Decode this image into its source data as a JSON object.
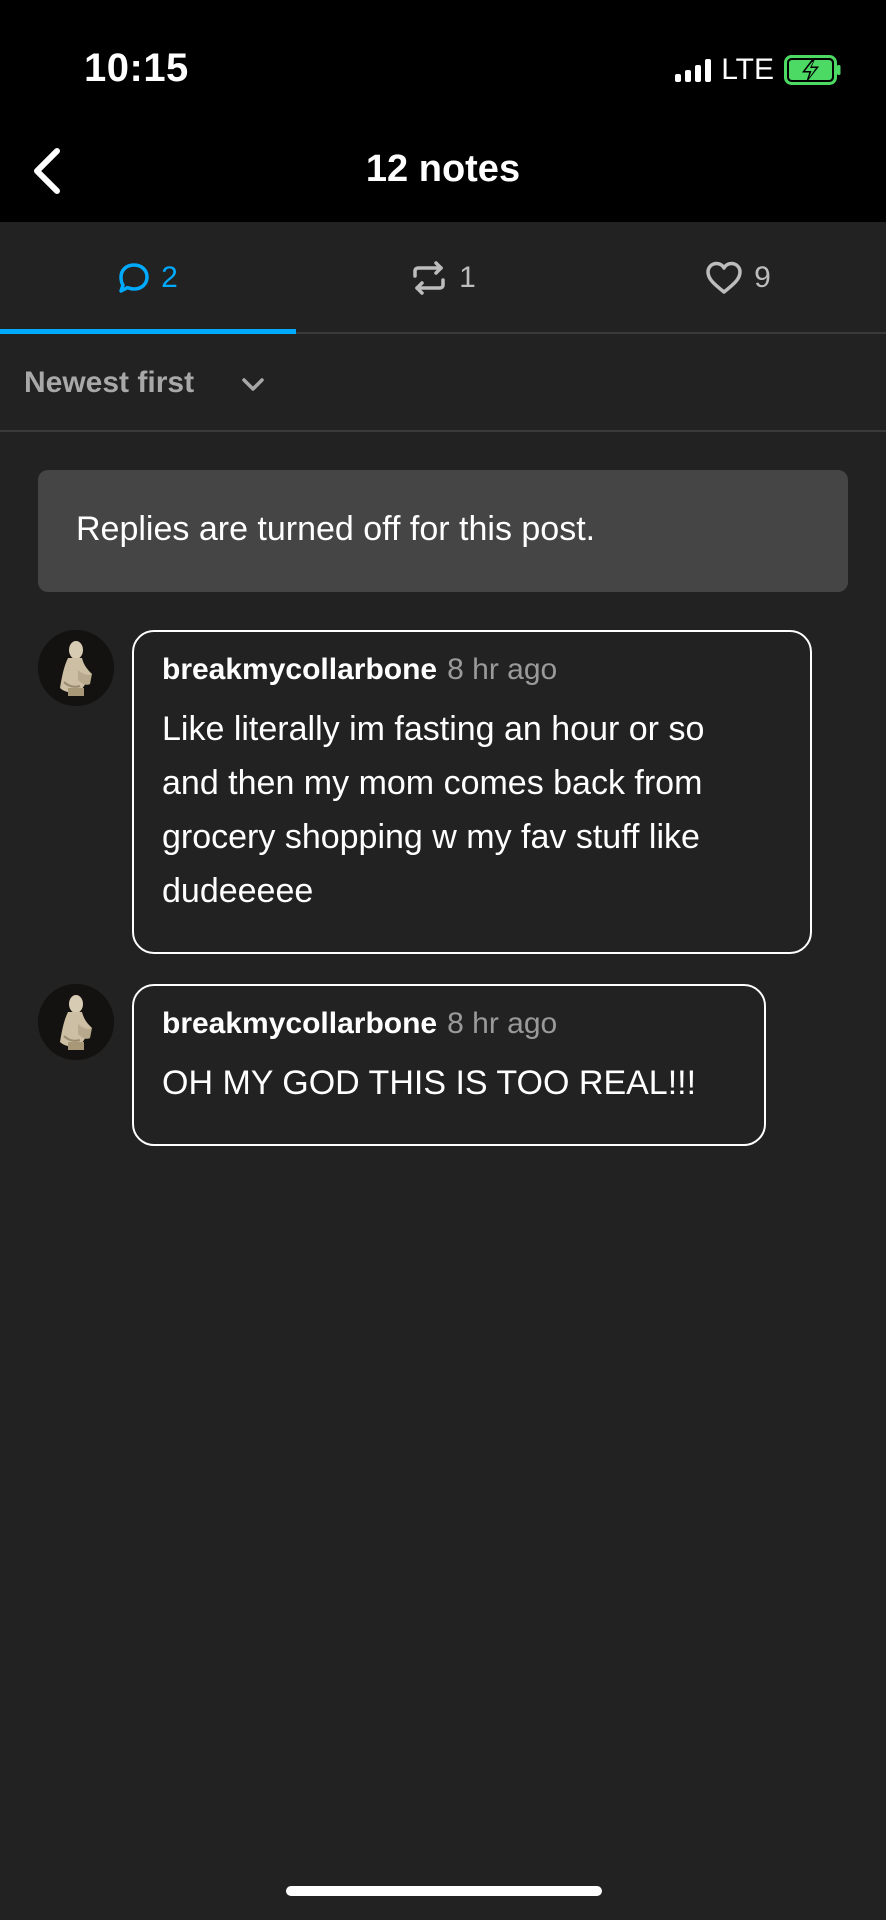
{
  "status_bar": {
    "time": "10:15",
    "network": "LTE",
    "battery_state": "charging",
    "battery_color": "#4cd964"
  },
  "nav": {
    "title": "12 notes",
    "back_icon": "chevron-left-icon"
  },
  "tabs": [
    {
      "icon": "reply-bubble-icon",
      "count": "2",
      "selected": true
    },
    {
      "icon": "reblog-icon",
      "count": "1",
      "selected": false
    },
    {
      "icon": "heart-icon",
      "count": "9",
      "selected": false
    }
  ],
  "sort": {
    "label": "Newest first",
    "icon": "chevron-down-icon"
  },
  "notice": {
    "text": "Replies are turned off for this post."
  },
  "replies": [
    {
      "username": "breakmycollarbone",
      "time": "8 hr ago",
      "lines": [
        "Like literally im fasting an hour or so",
        "and then my mom comes back from",
        "grocery shopping w my fav stuff like",
        "dudeeeee"
      ]
    },
    {
      "username": "breakmycollarbone",
      "time": "8 hr ago",
      "lines": [
        "OH MY GOD THIS IS TOO REAL!!!"
      ]
    }
  ],
  "colors": {
    "accent": "#00aaff",
    "background": "#222222",
    "notice_bg": "#454545"
  }
}
